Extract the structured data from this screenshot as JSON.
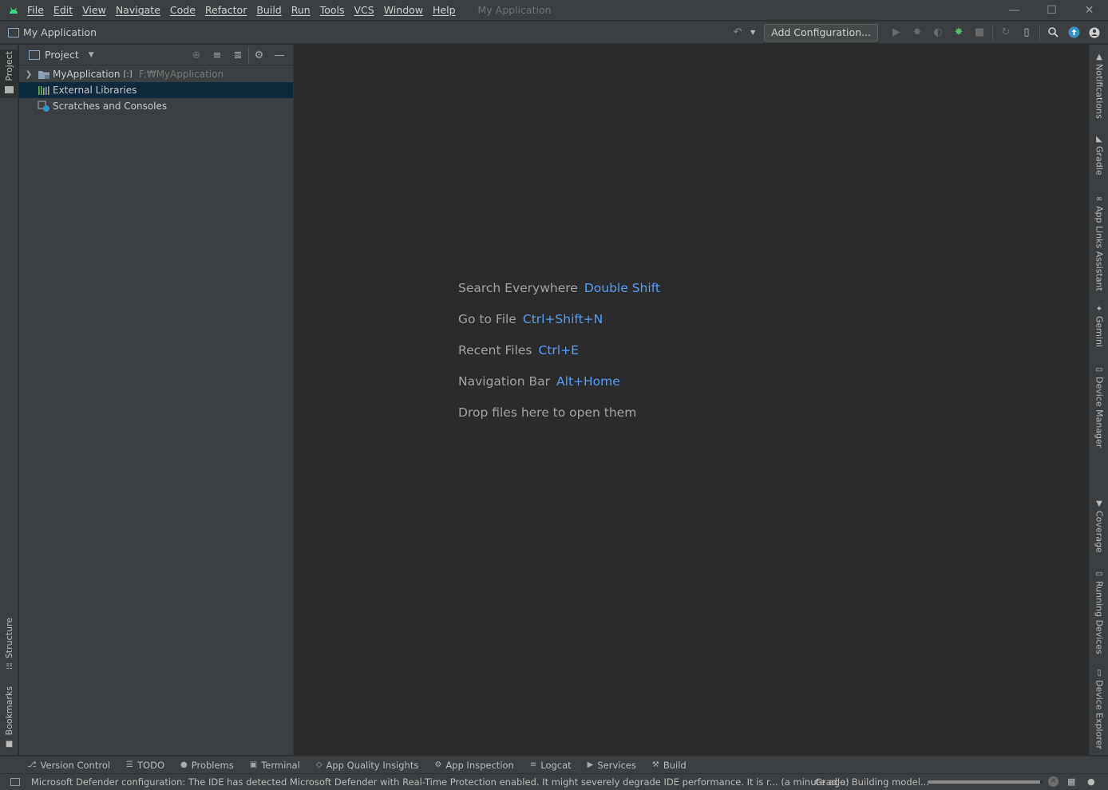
{
  "menubar": {
    "items": [
      "File",
      "Edit",
      "View",
      "Navigate",
      "Code",
      "Refactor",
      "Build",
      "Run",
      "Tools",
      "VCS",
      "Window",
      "Help"
    ],
    "app_title": "My Application",
    "window_controls": {
      "minimize": "—",
      "maximize": "☐",
      "close": "✕"
    }
  },
  "navbar": {
    "project_name": "My Application",
    "add_configuration": "Add Configuration..."
  },
  "left_stripe": {
    "project": "Project",
    "structure": "Structure",
    "bookmarks": "Bookmarks"
  },
  "project_panel": {
    "title": "Project",
    "tree": [
      {
        "label": "MyApplication",
        "badge": "[:]",
        "path": "F:₩MyApplication",
        "expandable": true,
        "selected": false
      },
      {
        "label": "External Libraries",
        "expandable": false,
        "selected": true
      },
      {
        "label": "Scratches and Consoles",
        "expandable": false,
        "selected": false
      }
    ]
  },
  "editor": {
    "hints": [
      {
        "label": "Search Everywhere",
        "shortcut": "Double Shift"
      },
      {
        "label": "Go to File",
        "shortcut": "Ctrl+Shift+N"
      },
      {
        "label": "Recent Files",
        "shortcut": "Ctrl+E"
      },
      {
        "label": "Navigation Bar",
        "shortcut": "Alt+Home"
      },
      {
        "label": "Drop files here to open them",
        "shortcut": ""
      }
    ]
  },
  "right_stripe": {
    "items": [
      "Notifications",
      "Gradle",
      "App Links Assistant",
      "Gemini",
      "Device Manager",
      "Coverage",
      "Running Devices",
      "Device Explorer"
    ]
  },
  "bottom_tools": {
    "items": [
      "Version Control",
      "TODO",
      "Problems",
      "Terminal",
      "App Quality Insights",
      "App Inspection",
      "Logcat",
      "Services",
      "Build"
    ]
  },
  "status_bar": {
    "message": "Microsoft Defender configuration: The IDE has detected Microsoft Defender with Real-Time Protection enabled. It might severely degrade IDE performance. It is r... (a minute ago)",
    "gradle_status": "Gradle: Building model...",
    "progress": 0.97
  },
  "colors": {
    "accent_link": "#589df6",
    "selection": "#0d293e",
    "panel_bg": "#3c3f41",
    "editor_bg": "#2b2b2b",
    "android_green": "#3ddc84"
  }
}
